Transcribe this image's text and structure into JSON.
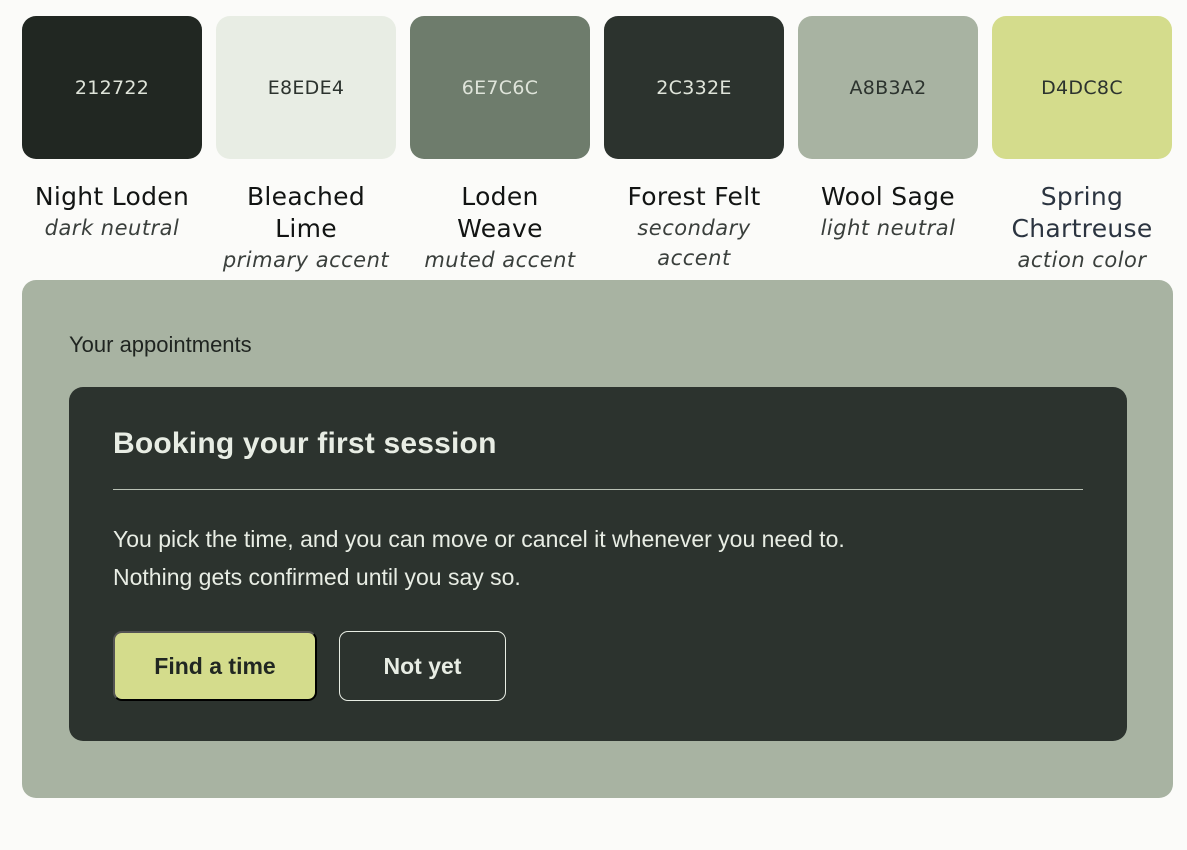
{
  "palette": [
    {
      "hex": "212722",
      "color": "#212722",
      "name": "Night Loden",
      "role": "dark neutral",
      "tone": "dark"
    },
    {
      "hex": "E8EDE4",
      "color": "#E8EDE4",
      "name": "Bleached Lime",
      "role": "primary accent",
      "tone": "light"
    },
    {
      "hex": "6E7C6C",
      "color": "#6E7C6C",
      "name": "Loden Weave",
      "role": "muted accent",
      "tone": "dark"
    },
    {
      "hex": "2C332E",
      "color": "#2C332E",
      "name": "Forest Felt",
      "role": "secondary accent",
      "tone": "dark"
    },
    {
      "hex": "A8B3A2",
      "color": "#A8B3A2",
      "name": "Wool Sage",
      "role": "light neutral",
      "tone": "light"
    },
    {
      "hex": "D4DC8C",
      "color": "#D4DC8C",
      "name": "Spring Chartreuse",
      "role": "action color",
      "tone": "light"
    }
  ],
  "appointments": {
    "section_title": "Your appointments",
    "card": {
      "title": "Booking your first session",
      "body_line_1": "You pick the time, and you can move or cancel it whenever you need to.",
      "body_line_2": "Nothing gets confirmed until you say so.",
      "primary_button": "Find a time",
      "secondary_button": "Not yet"
    }
  },
  "colors": {
    "page_background": "#fbfbf9",
    "panel_background": "#a8b3a2",
    "card_background": "#2c332e",
    "card_text": "#e8ede4",
    "action": "#d4dc8c"
  }
}
